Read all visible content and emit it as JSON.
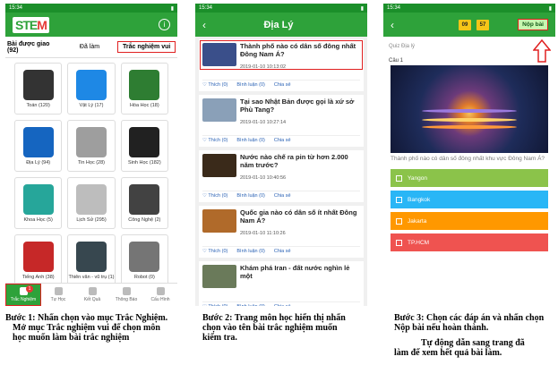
{
  "phone1": {
    "status_time": "15:34",
    "logo_a": "STE",
    "logo_b": "M",
    "tabs": [
      "Bài được giao (92)",
      "Đã làm",
      "Trắc nghiệm vui"
    ],
    "subjects": [
      {
        "label": "Toán (120)",
        "color": "#333333"
      },
      {
        "label": "Vật Lý (17)",
        "color": "#1e88e5"
      },
      {
        "label": "Hóa Học (18)",
        "color": "#2e7d32"
      },
      {
        "label": "Địa Lý (94)",
        "color": "#1565c0"
      },
      {
        "label": "Tin Học (28)",
        "color": "#9e9e9e"
      },
      {
        "label": "Sinh Học (182)",
        "color": "#212121"
      },
      {
        "label": "Khoa Học (5)",
        "color": "#26a69a"
      },
      {
        "label": "Lịch Sử (295)",
        "color": "#bdbdbd"
      },
      {
        "label": "Công Nghệ (2)",
        "color": "#424242"
      },
      {
        "label": "Tiếng Anh (38)",
        "color": "#c62828"
      },
      {
        "label": "Thiên văn - vũ trụ (1)",
        "color": "#37474f"
      },
      {
        "label": "Robot (0)",
        "color": "#757575"
      }
    ],
    "nav": [
      "Trắc Nghiệm",
      "Tự Học",
      "Kết Quả",
      "Thông Báo",
      "Cấu Hình"
    ],
    "notif_count": "1"
  },
  "phone2": {
    "status_time": "15:34",
    "title": "Địa Lý",
    "actions": [
      "♡ Thích (0)",
      "Bình luận (0)",
      "Chia sẻ"
    ],
    "cards": [
      {
        "title": "Thành phố nào có dân số đông nhất Đông Nam Á?",
        "date": "2019-01-10 10:13:02",
        "color": "#3a4f8a"
      },
      {
        "title": "Tại sao Nhật Bản được gọi là xứ sở Phù Tang?",
        "date": "2019-01-10 10:27:14",
        "color": "#8aa0b8"
      },
      {
        "title": "Nước nào chế ra pin từ hơn 2.000 năm trước?",
        "date": "2019-01-10 10:40:56",
        "color": "#3a2a1a"
      },
      {
        "title": "Quốc gia nào có dân số ít nhất Đông Nam Á?",
        "date": "2019-01-10 11:10:26",
        "color": "#b06a2a"
      },
      {
        "title": "Khám phá Iran - đất nước nghìn lẻ một",
        "date": "",
        "color": "#6a7a5a"
      }
    ]
  },
  "phone3": {
    "status_time": "15:34",
    "timer_min": "09",
    "timer_sec": "57",
    "submit": "Nộp bài",
    "quiz_label": "Quiz Địa lý",
    "question_no": "Câu 1",
    "question": "Thành phố nào có dân số đông nhất khu vực Đông Nam Á?",
    "options": [
      {
        "label": "Yangon",
        "color": "#8bc34a"
      },
      {
        "label": "Bangkok",
        "color": "#29b6f6"
      },
      {
        "label": "Jakarta",
        "color": "#ff9800"
      },
      {
        "label": "TP.HCM",
        "color": "#ef5350"
      }
    ]
  },
  "captions": {
    "c1a": "Bước 1: Nhấn chọn vào mục Trắc Nghiệm.",
    "c1b": "Mở mục Trắc nghiệm vui để chọn môn",
    "c1c": "học muốn làm bài trắc nghiệm",
    "c2a": "Bước 2: Trang môn học hiển thị nhấn",
    "c2b": "chọn vào tên bài trắc nghiệm muốn",
    "c2c": "kiểm tra.",
    "c3a": "Bước 3: Chọn các đáp án và nhấn chọn",
    "c3b": "Nộp bài nếu hoàn thành.",
    "c3c": "Tự động dẫn sang trang đã",
    "c3d": "làm để xem hết quả bài làm."
  }
}
